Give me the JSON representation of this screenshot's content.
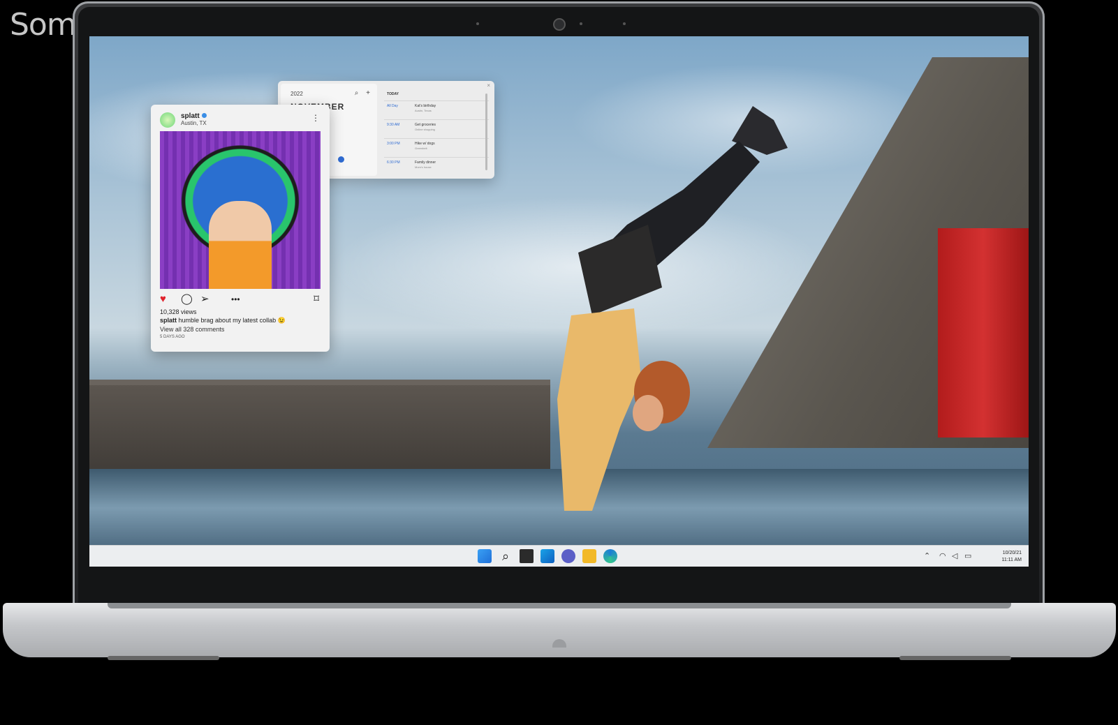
{
  "watermark": "Somon.tj",
  "post": {
    "username": "splatt",
    "location": "Austin, TX",
    "more": "⋮",
    "views": "10,328 views",
    "caption_user": "splatt",
    "caption_text": " humble brag about my latest collab ",
    "caption_emoji": "😉",
    "comments_link": "View all 328 comments",
    "time": "5 DAYS AGO",
    "icons": [
      "heart-icon",
      "comment-icon",
      "send-icon",
      "more-icon",
      "bookmark-icon"
    ]
  },
  "calendar": {
    "year_label": "2022",
    "month_label": "NOVEMBER",
    "today_header": "TODAY",
    "events": [
      {
        "time": "All Day",
        "title": "Kat's birthday",
        "sub": "Austin, Texas"
      },
      {
        "time": "9:30 AM",
        "title": "Get groceries",
        "sub": "Online shopping"
      },
      {
        "time": "3:00 PM",
        "title": "Hike w/ dogs",
        "sub": "Greenbelt"
      },
      {
        "time": "6:30 PM",
        "title": "Family dinner",
        "sub": "Mom's house"
      }
    ]
  },
  "taskbar": {
    "apps": [
      "windows-start-icon",
      "search-icon",
      "task-view-icon",
      "widgets-icon",
      "teams-chat-icon",
      "file-explorer-icon",
      "edge-browser-icon"
    ],
    "date": "10/20/21",
    "time": "11:11 AM"
  },
  "colors": {
    "accent": "#2f6bd1",
    "heart": "#e0222c",
    "red_door": "#c82626"
  }
}
